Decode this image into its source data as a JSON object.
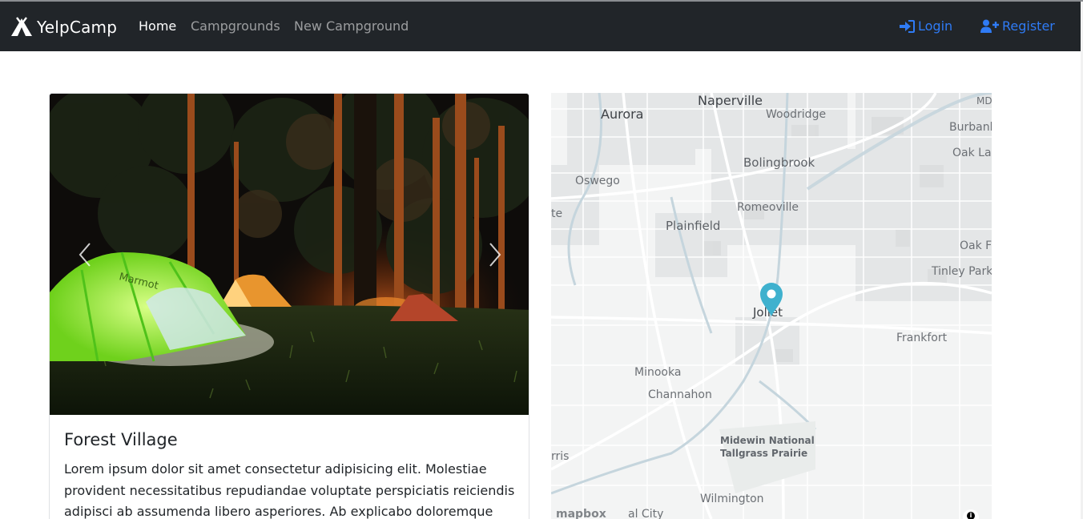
{
  "navbar": {
    "brand": "YelpCamp",
    "links": [
      {
        "label": "Home",
        "active": true
      },
      {
        "label": "Campgrounds",
        "active": false
      },
      {
        "label": "New Campground",
        "active": false
      }
    ],
    "auth": {
      "login": "Login",
      "register": "Register"
    },
    "colors": {
      "background": "#212529",
      "auth_link": "#2f7bf5"
    },
    "icons": {
      "brand": "campground-icon",
      "login": "sign-in-icon",
      "register": "user-plus-icon"
    }
  },
  "campground": {
    "title": "Forest Village",
    "description": "Lorem ipsum dolor sit amet consectetur adipisicing elit. Molestiae provident necessitatibus repudiandae voluptate perspiciatis reiciendis adipisci ab assumenda libero asperiores. Ab explicabo doloremque",
    "carousel": {
      "prev_icon": "chevron-left-icon",
      "next_icon": "chevron-right-icon"
    }
  },
  "map": {
    "labels": [
      "Naperville",
      "Aurora",
      "Woodridge",
      "MD",
      "Burbank",
      "Oak Lav",
      "Bolingbrook",
      "Oswego",
      "Romeoville",
      "te",
      "Plainfield",
      "Oak Fo",
      "Tinley Park",
      "Joliet",
      "Frankfort",
      "Minooka",
      "Channahon",
      "Midewin National",
      "Tallgrass Prairie",
      "rris",
      "Wilmington",
      "al City"
    ],
    "attribution": "mapbox",
    "info_icon": "info-icon",
    "marker_icon": "map-marker-icon",
    "marker_color": "#3fb1ce"
  }
}
